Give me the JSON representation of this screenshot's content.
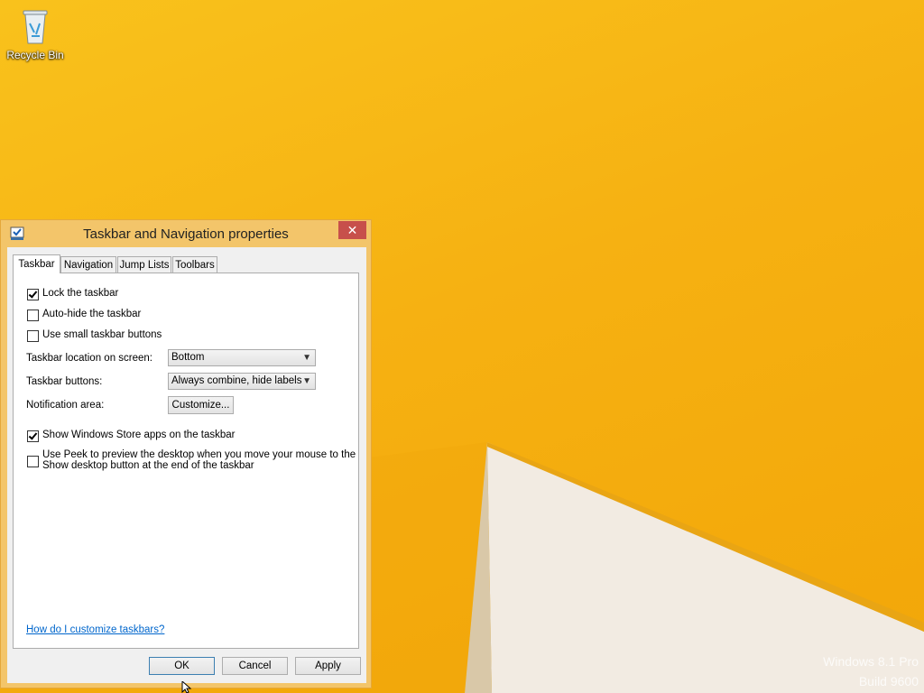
{
  "desktop": {
    "recycle_bin_label": "Recycle Bin",
    "watermark_line1": "Windows 8.1 Pro",
    "watermark_line2": "Build 9600"
  },
  "window": {
    "title": "Taskbar and Navigation properties",
    "close_glyph": "✕",
    "tabs": [
      "Taskbar",
      "Navigation",
      "Jump Lists",
      "Toolbars"
    ],
    "active_tab": "Taskbar",
    "options": {
      "lock_taskbar": {
        "label": "Lock the taskbar",
        "checked": true
      },
      "auto_hide": {
        "label": "Auto-hide the taskbar",
        "checked": false
      },
      "small_buttons": {
        "label": "Use small taskbar buttons",
        "checked": false
      },
      "store_apps": {
        "label": "Show Windows Store apps on the taskbar",
        "checked": true
      },
      "peek_line1": "Use Peek to preview the desktop when you move your mouse to the",
      "peek_line2": "Show desktop button at the end of the taskbar",
      "peek_checked": false
    },
    "location_label": "Taskbar location on screen:",
    "location_value": "Bottom",
    "buttons_label": "Taskbar buttons:",
    "buttons_value": "Always combine, hide labels",
    "notification_label": "Notification area:",
    "customize_label": "Customize...",
    "help_link": "How do I customize taskbars?",
    "ok_label": "OK",
    "cancel_label": "Cancel",
    "apply_label": "Apply",
    "dropdown_glyph": "▼"
  },
  "colors": {
    "desktop_bg": "#f6b112",
    "window_frame": "#f3c56a",
    "close_button": "#c7504b",
    "link": "#0066cc"
  }
}
